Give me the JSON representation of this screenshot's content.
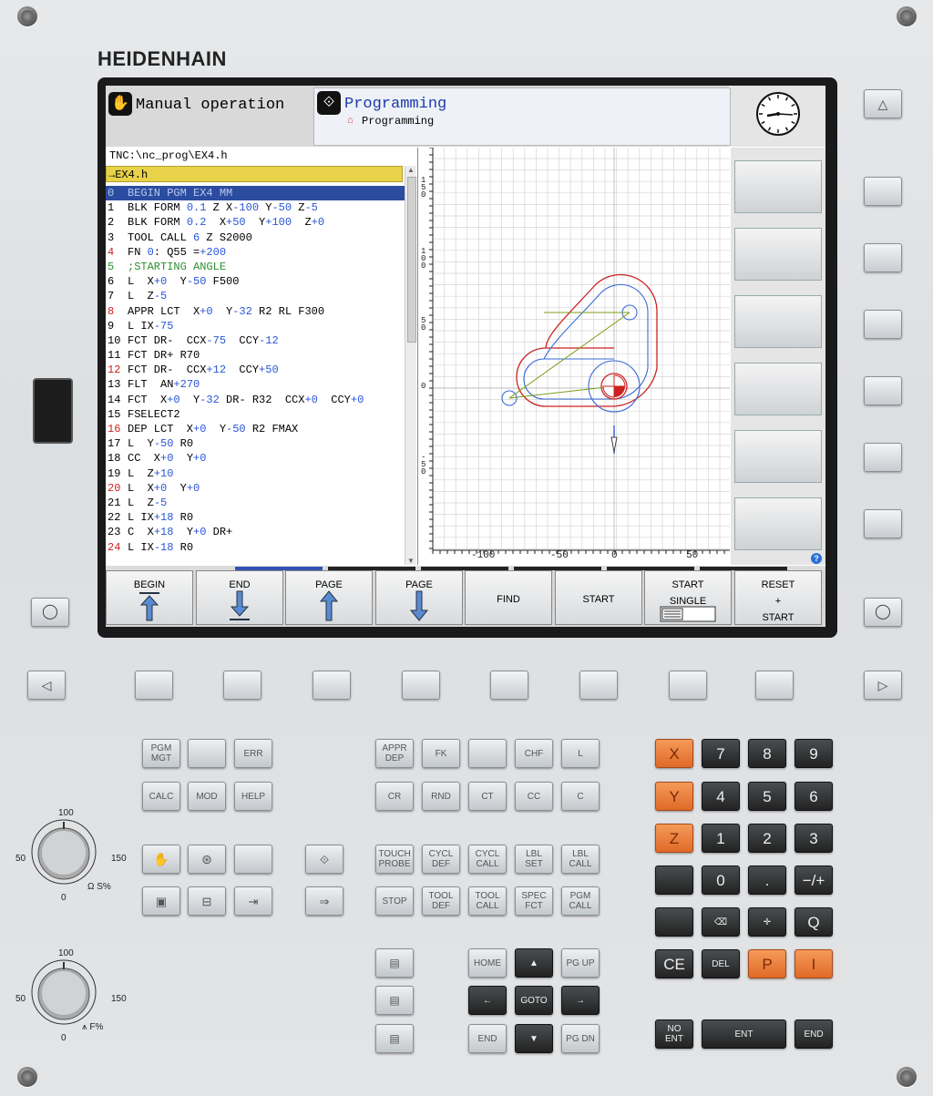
{
  "brand": "HEIDENHAIN",
  "modes": {
    "machine_label": "Manual operation",
    "programming_label": "Programming",
    "programming_sub": "Programming"
  },
  "file": {
    "path": "TNC:\\nc_prog\\EX4.h",
    "tab": "→EX4.h"
  },
  "program_lines": [
    {
      "n": "0",
      "parts": [
        [
          "BEGIN PGM EX4 MM",
          "t"
        ]
      ],
      "sel": true
    },
    {
      "n": "1",
      "parts": [
        [
          "BLK FORM ",
          "t"
        ],
        [
          "0.1",
          "v"
        ],
        [
          " Z X",
          "t"
        ],
        [
          "-100",
          "v"
        ],
        [
          " Y",
          "t"
        ],
        [
          "-50",
          "v"
        ],
        [
          " Z",
          "t"
        ],
        [
          "-5",
          "v"
        ]
      ]
    },
    {
      "n": "2",
      "parts": [
        [
          "BLK FORM ",
          "t"
        ],
        [
          "0.2",
          "v"
        ],
        [
          "  X",
          "t"
        ],
        [
          "+50",
          "v"
        ],
        [
          "  Y",
          "t"
        ],
        [
          "+100",
          "v"
        ],
        [
          "  Z",
          "t"
        ],
        [
          "+0",
          "v"
        ]
      ]
    },
    {
      "n": "3",
      "parts": [
        [
          "TOOL CALL ",
          "t"
        ],
        [
          "6",
          "v"
        ],
        [
          " Z S2000",
          "t"
        ]
      ]
    },
    {
      "n": "4",
      "parts": [
        [
          "FN ",
          "t"
        ],
        [
          "0",
          "v"
        ],
        [
          ": Q55 =",
          "t"
        ],
        [
          "+200",
          "v"
        ]
      ]
    },
    {
      "n": "5",
      "parts": [
        [
          ";STARTING ANGLE",
          "c"
        ]
      ]
    },
    {
      "n": "6",
      "parts": [
        [
          "L  X",
          "t"
        ],
        [
          "+0",
          "v"
        ],
        [
          "  Y",
          "t"
        ],
        [
          "-50",
          "v"
        ],
        [
          " F500",
          "t"
        ]
      ]
    },
    {
      "n": "7",
      "parts": [
        [
          "L  Z",
          "t"
        ],
        [
          "-5",
          "v"
        ]
      ]
    },
    {
      "n": "8",
      "parts": [
        [
          "APPR LCT  X",
          "t"
        ],
        [
          "+0",
          "v"
        ],
        [
          "  Y",
          "t"
        ],
        [
          "-32",
          "v"
        ],
        [
          " R2 RL F300",
          "t"
        ]
      ]
    },
    {
      "n": "9",
      "parts": [
        [
          "L IX",
          "t"
        ],
        [
          "-75",
          "v"
        ]
      ]
    },
    {
      "n": "10",
      "parts": [
        [
          "FCT DR-  CCX",
          "t"
        ],
        [
          "-75",
          "v"
        ],
        [
          "  CCY",
          "t"
        ],
        [
          "-12",
          "v"
        ]
      ]
    },
    {
      "n": "11",
      "parts": [
        [
          "FCT DR+ R70",
          "t"
        ]
      ]
    },
    {
      "n": "12",
      "parts": [
        [
          "FCT DR-  CCX",
          "t"
        ],
        [
          "+12",
          "v"
        ],
        [
          "  CCY",
          "t"
        ],
        [
          "+50",
          "v"
        ]
      ]
    },
    {
      "n": "13",
      "parts": [
        [
          "FLT  AN",
          "t"
        ],
        [
          "+270",
          "v"
        ]
      ]
    },
    {
      "n": "14",
      "parts": [
        [
          "FCT  X",
          "t"
        ],
        [
          "+0",
          "v"
        ],
        [
          "  Y",
          "t"
        ],
        [
          "-32",
          "v"
        ],
        [
          " DR- R32  CCX",
          "t"
        ],
        [
          "+0",
          "v"
        ],
        [
          "  CCY",
          "t"
        ],
        [
          "+0",
          "v"
        ]
      ]
    },
    {
      "n": "15",
      "parts": [
        [
          "FSELECT2",
          "t"
        ]
      ]
    },
    {
      "n": "16",
      "parts": [
        [
          "DEP LCT  X",
          "t"
        ],
        [
          "+0",
          "v"
        ],
        [
          "  Y",
          "t"
        ],
        [
          "-50",
          "v"
        ],
        [
          " R2 FMAX",
          "t"
        ]
      ]
    },
    {
      "n": "17",
      "parts": [
        [
          "L  Y",
          "t"
        ],
        [
          "-50",
          "v"
        ],
        [
          " R0",
          "t"
        ]
      ]
    },
    {
      "n": "18",
      "parts": [
        [
          "CC  X",
          "t"
        ],
        [
          "+0",
          "v"
        ],
        [
          "  Y",
          "t"
        ],
        [
          "+0",
          "v"
        ]
      ]
    },
    {
      "n": "19",
      "parts": [
        [
          "L  Z",
          "t"
        ],
        [
          "+10",
          "v"
        ]
      ]
    },
    {
      "n": "20",
      "parts": [
        [
          "L  X",
          "t"
        ],
        [
          "+0",
          "v"
        ],
        [
          "  Y",
          "t"
        ],
        [
          "+0",
          "v"
        ]
      ]
    },
    {
      "n": "21",
      "parts": [
        [
          "L  Z",
          "t"
        ],
        [
          "-5",
          "v"
        ]
      ]
    },
    {
      "n": "22",
      "parts": [
        [
          "L IX",
          "t"
        ],
        [
          "+18",
          "v"
        ],
        [
          " R0",
          "t"
        ]
      ]
    },
    {
      "n": "23",
      "parts": [
        [
          "C  X",
          "t"
        ],
        [
          "+18",
          "v"
        ],
        [
          "  Y",
          "t"
        ],
        [
          "+0",
          "v"
        ],
        [
          " DR+",
          "t"
        ]
      ]
    },
    {
      "n": "24",
      "parts": [
        [
          "L IX",
          "t"
        ],
        [
          "-18",
          "v"
        ],
        [
          " R0",
          "t"
        ]
      ]
    }
  ],
  "graphic_ticks": {
    "x": [
      "-100",
      "-50",
      "0",
      "50"
    ],
    "y": [
      "150",
      "100",
      "50",
      "0",
      "-50"
    ]
  },
  "softkeys": [
    {
      "label": "BEGIN",
      "icon": "arrow-up-bar-icon"
    },
    {
      "label": "END",
      "icon": "arrow-down-bar-icon"
    },
    {
      "label": "PAGE",
      "icon": "arrow-up-icon"
    },
    {
      "label": "PAGE",
      "icon": "arrow-down-icon"
    },
    {
      "label": "FIND",
      "icon": ""
    },
    {
      "label": "START",
      "icon": ""
    },
    {
      "label": "START\nSINGLE",
      "icon": "single-block-icon"
    },
    {
      "label": "RESET\n+\nSTART",
      "icon": ""
    }
  ],
  "keys": {
    "row1": [
      "PGM\nMGT",
      "",
      "ERR"
    ],
    "row2": [
      "CALC",
      "MOD",
      "HELP"
    ],
    "prog_row1": [
      "APPR\nDEP",
      "FK",
      "",
      "CHF",
      "L"
    ],
    "prog_row2": [
      "CR",
      "RND",
      "CT",
      "CC",
      "C"
    ],
    "prog_row3": [
      "TOUCH\nPROBE",
      "CYCL\nDEF",
      "CYCL\nCALL",
      "LBL\nSET",
      "LBL\nCALL"
    ],
    "prog_row4": [
      "STOP",
      "TOOL\nDEF",
      "TOOL\nCALL",
      "SPEC\nFCT",
      "PGM\nCALL"
    ],
    "nav": [
      "HOME",
      "PG UP",
      "GOTO",
      "END",
      "PG DN"
    ],
    "axes": [
      "X",
      "Y",
      "Z"
    ],
    "digits": [
      "7",
      "8",
      "9",
      "4",
      "5",
      "6",
      "1",
      "2",
      "3",
      "0",
      ".",
      "−/+"
    ],
    "special": [
      "Q",
      "CE",
      "DEL",
      "P",
      "I",
      "NO\nENT",
      "ENT",
      "END"
    ]
  },
  "override_knobs": [
    {
      "min": "50",
      "top": "100",
      "max": "150",
      "zero": "0",
      "label": "S%"
    },
    {
      "min": "50",
      "top": "100",
      "max": "150",
      "zero": "0",
      "label": "F%"
    }
  ]
}
